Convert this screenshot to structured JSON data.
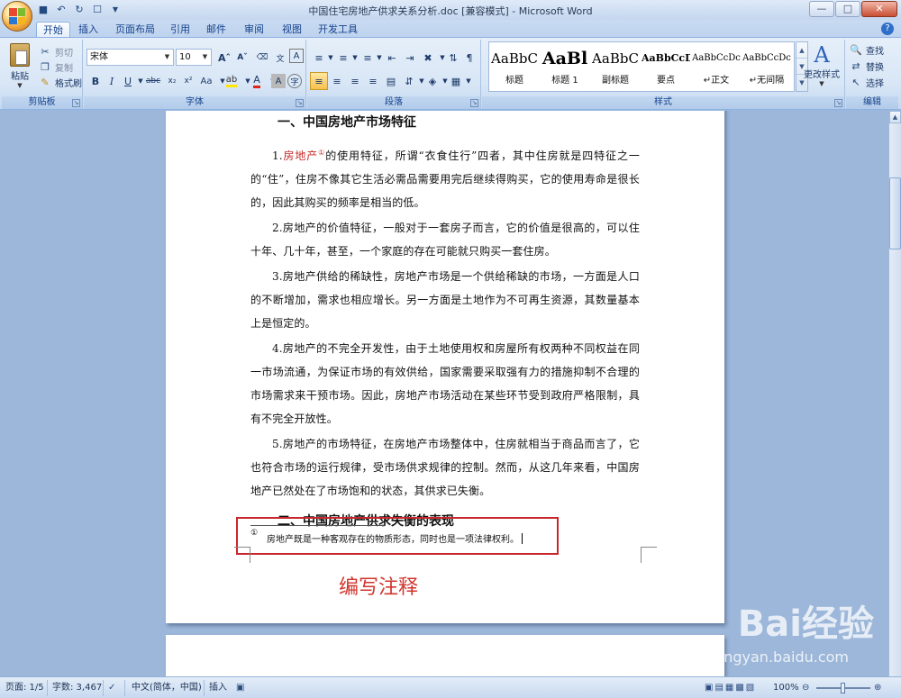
{
  "window": {
    "title": "中国住宅房地产供求关系分析.doc [兼容模式] - Microsoft Word",
    "controls": {
      "minimize": "—",
      "maximize": "□",
      "close": "✕"
    }
  },
  "quick_access": [
    "save-icon",
    "undo-icon",
    "redo-icon",
    "print-preview-icon"
  ],
  "tabs": [
    {
      "label": "开始",
      "active": true
    },
    {
      "label": "插入"
    },
    {
      "label": "页面布局"
    },
    {
      "label": "引用"
    },
    {
      "label": "邮件"
    },
    {
      "label": "审阅"
    },
    {
      "label": "视图"
    },
    {
      "label": "开发工具"
    }
  ],
  "ribbon": {
    "clipboard": {
      "label": "剪贴板",
      "paste": "粘贴",
      "cut": "剪切",
      "copy": "复制",
      "format_painter": "格式刷"
    },
    "font": {
      "label": "字体",
      "name": "宋体",
      "size": "10"
    },
    "paragraph": {
      "label": "段落"
    },
    "styles": {
      "label": "样式",
      "items": [
        {
          "preview": "AaBbC",
          "name": "标题"
        },
        {
          "preview": "AaBl",
          "name": "标题 1"
        },
        {
          "preview": "AaBbC",
          "name": "副标题"
        },
        {
          "preview": "AaBbCcD",
          "name": "要点"
        },
        {
          "preview": "AaBbCcDc",
          "name": "↵正文"
        },
        {
          "preview": "AaBbCcDc",
          "name": "↵无间隔"
        }
      ],
      "change_styles": "更改样式"
    },
    "editing": {
      "label": "编辑",
      "find": "查找",
      "replace": "替换",
      "select": "选择"
    }
  },
  "document": {
    "heading1": "一、中国房地产市场特征",
    "paragraphs": [
      {
        "prefix": "1.",
        "red": "房地产",
        "sup": "①",
        "text": "的使用特征，所谓“衣食住行”四者，其中住房就是四特征之一的“住”，住房不像其它生活必需品需要用完后继续得购买，它的使用寿命是很长的，因此其购买的频率是相当的低。"
      },
      {
        "text": "2.房地产的价值特征，一般对于一套房子而言，它的价值是很高的，可以住十年、几十年，甚至，一个家庭的存在可能就只购买一套住房。"
      },
      {
        "text": "3.房地产供给的稀缺性，房地产市场是一个供给稀缺的市场，一方面是人口的不断增加，需求也相应增长。另一方面是土地作为不可再生资源，其数量基本上是恒定的。"
      },
      {
        "text": "4.房地产的不完全开发性，由于土地使用权和房屋所有权两种不同权益在同一市场流通，为保证市场的有效供给，国家需要采取强有力的措施抑制不合理的市场需求来干预市场。因此，房地产市场活动在某些环节受到政府严格限制，具有不完全开放性。"
      },
      {
        "text": "5.房地产的市场特征，在房地产市场整体中，住房就相当于商品而言了，它也符合市场的运行规律，受市场供求规律的控制。然而，从这几年来看，中国房地产已然处在了市场饱和的状态，其供求已失衡。"
      }
    ],
    "heading2": "二、中国房地产供求失衡的表现",
    "footnote": {
      "mark": "①",
      "text": "房地产既是一种客观存在的物质形态，同时也是一项法律权利。"
    },
    "annotation": "编写注释"
  },
  "status": {
    "page": "页面: 1/5",
    "words": "字数: 3,467",
    "language": "中文(简体，中国)",
    "mode": "插入",
    "zoom": "100%"
  },
  "watermark": {
    "main": "Bai经验",
    "sub": "jingyan.baidu.com"
  },
  "colors": {
    "accent": "#15428b",
    "annotation": "#d1352d",
    "highlight_border": "#c8282b"
  }
}
